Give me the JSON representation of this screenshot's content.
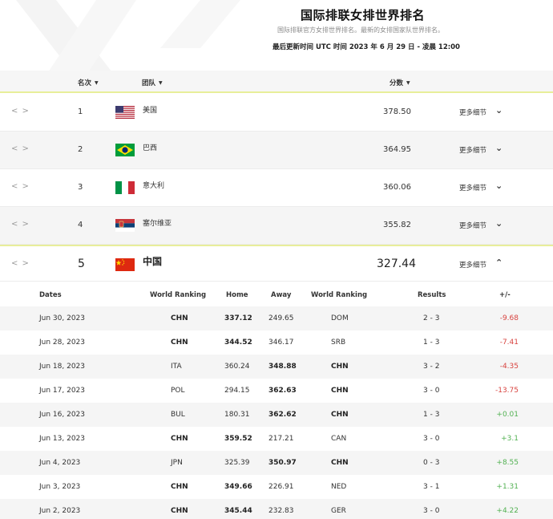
{
  "header": {
    "title": "国际排联女排世界排名",
    "subtitle": "国际排联官方女排世界排名。最新的女排国家队世界排名。",
    "updated": "最后更新时间 UTC 时间 2023 年 6 月 29 日 - 凌晨 12:00"
  },
  "table_header": {
    "rank": "名次",
    "team": "团队",
    "points": "分数"
  },
  "rankings": [
    {
      "rank": "1",
      "team": "美国",
      "points": "378.50",
      "details": "更多细节"
    },
    {
      "rank": "2",
      "team": "巴西",
      "points": "364.95",
      "details": "更多细节"
    },
    {
      "rank": "3",
      "team": "意大利",
      "points": "360.06",
      "details": "更多细节"
    },
    {
      "rank": "4",
      "team": "塞尔维亚",
      "points": "355.82",
      "details": "更多细节"
    },
    {
      "rank": "5",
      "team": "中国",
      "points": "327.44",
      "details": "更多细节"
    }
  ],
  "match_header": {
    "dates": "Dates",
    "world_ranking_a": "World Ranking",
    "home": "Home",
    "away": "Away",
    "world_ranking_b": "World Ranking",
    "results": "Results",
    "diff": "+/-"
  },
  "matches": [
    {
      "date": "Jun 30, 2023",
      "team_a": "CHN",
      "home": "337.12",
      "away": "249.65",
      "team_b": "DOM",
      "result": "2 - 3",
      "diff": "-9.68"
    },
    {
      "date": "Jun 28, 2023",
      "team_a": "CHN",
      "home": "344.52",
      "away": "346.17",
      "team_b": "SRB",
      "result": "1 - 3",
      "diff": "-7.41"
    },
    {
      "date": "Jun 18, 2023",
      "team_a": "ITA",
      "home": "360.24",
      "away": "348.88",
      "team_b": "CHN",
      "result": "3 - 2",
      "diff": "-4.35"
    },
    {
      "date": "Jun 17, 2023",
      "team_a": "POL",
      "home": "294.15",
      "away": "362.63",
      "team_b": "CHN",
      "result": "3 - 0",
      "diff": "-13.75"
    },
    {
      "date": "Jun 16, 2023",
      "team_a": "BUL",
      "home": "180.31",
      "away": "362.62",
      "team_b": "CHN",
      "result": "1 - 3",
      "diff": "+0.01"
    },
    {
      "date": "Jun 13, 2023",
      "team_a": "CHN",
      "home": "359.52",
      "away": "217.21",
      "team_b": "CAN",
      "result": "3 - 0",
      "diff": "+3.1"
    },
    {
      "date": "Jun 4, 2023",
      "team_a": "JPN",
      "home": "325.39",
      "away": "350.97",
      "team_b": "CHN",
      "result": "0 - 3",
      "diff": "+8.55"
    },
    {
      "date": "Jun 3, 2023",
      "team_a": "CHN",
      "home": "349.66",
      "away": "226.91",
      "team_b": "NED",
      "result": "3 - 1",
      "diff": "+1.31"
    },
    {
      "date": "Jun 2, 2023",
      "team_a": "CHN",
      "home": "345.44",
      "away": "232.83",
      "team_b": "GER",
      "result": "3 - 0",
      "diff": "+4.22"
    }
  ],
  "colors": {
    "accent_line": "#e8ee9a",
    "negative": "#d8433f",
    "positive": "#52b152"
  }
}
